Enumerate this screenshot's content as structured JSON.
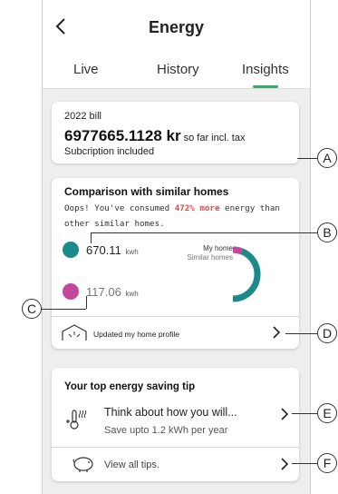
{
  "header": {
    "title": "Energy",
    "tabs": [
      {
        "label": "Live"
      },
      {
        "label": "History"
      },
      {
        "label": "Insights",
        "active": true
      }
    ]
  },
  "bill": {
    "year_label": "2022 bill",
    "amount": "6977665.1128 kr",
    "amount_suffix": "so far incl. tax",
    "subscription": "Subcription included"
  },
  "comparison": {
    "title": "Comparison with similar homes",
    "text_before": "Oops! You've consumed ",
    "highlight": "472% more",
    "text_after": " energy than other similar homes.",
    "my_home_value": "670.11",
    "similar_homes_value": "117.06",
    "unit": "kwh",
    "legend_my_home": "My home",
    "legend_similar": "Similar homes",
    "profile_link": "Updated my home profile"
  },
  "tips": {
    "title": "Your top energy saving tip",
    "tip_main": "Think about how you will...",
    "tip_sub": "Save upto 1.2 kWh per year",
    "view_all": "View all tips."
  },
  "callouts": [
    "A",
    "B",
    "C",
    "D",
    "E",
    "F"
  ],
  "colors": {
    "my_home": "#1b8a8a",
    "similar_homes": "#c4479e",
    "highlight": "#e04a4a",
    "tab_underline": "#3aaa6a"
  }
}
